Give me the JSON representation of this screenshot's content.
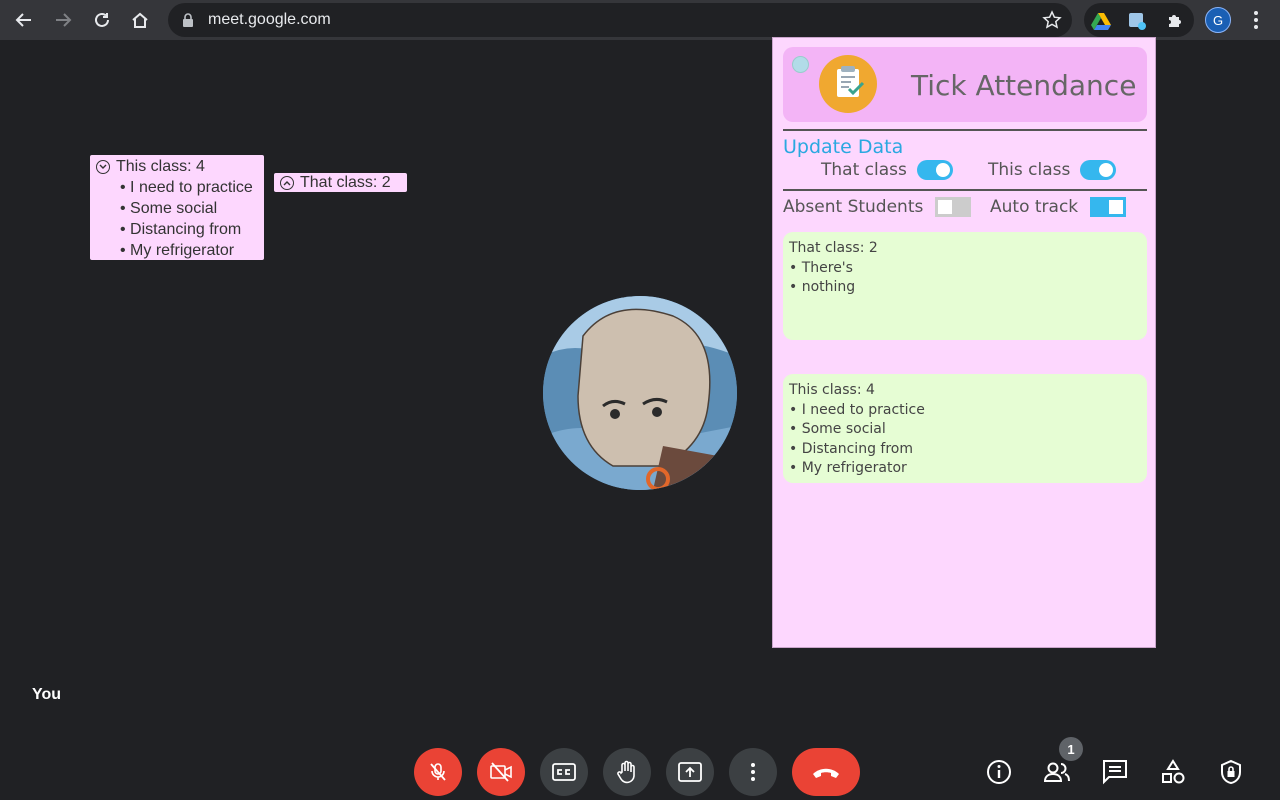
{
  "browser": {
    "url": "meet.google.com",
    "profile_initial": "G"
  },
  "notes": {
    "this_class": {
      "header": "This class: 4",
      "items": [
        "• I need to practice",
        "• Some social",
        "• Distancing from",
        "• My refrigerator"
      ]
    },
    "that_class": {
      "header": "That class: 2"
    }
  },
  "panel": {
    "title": "Tick Attendance",
    "update_data": "Update Data",
    "toggle_that": "That class",
    "toggle_this": "This class",
    "absent_students": "Absent Students",
    "auto_track": "Auto track",
    "that_box": [
      "That class: 2",
      "• There's",
      "• nothing"
    ],
    "this_box": [
      "This class: 4",
      "• I need to practice",
      "• Some social",
      "• Distancing from",
      "• My refrigerator"
    ]
  },
  "meeting": {
    "self_label": "You",
    "participant_count": "1"
  },
  "colors": {
    "panel_bg": "#fdd7fe",
    "accent": "#35b7ee",
    "box_bg": "#e6fdd4",
    "hangup": "#ea4335"
  }
}
